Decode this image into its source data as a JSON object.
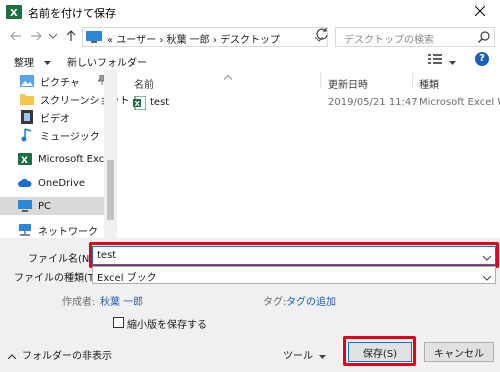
{
  "window": {
    "title": "名前を付けて保存",
    "icon": "excel-icon"
  },
  "navigation": {
    "breadcrumb_prefix": "«",
    "breadcrumbs": [
      "ユーザー",
      "秋葉 一郎",
      "デスクトップ"
    ],
    "separator": "›",
    "search_placeholder": "デスクトップの検索"
  },
  "toolbar": {
    "organize_label": "整理",
    "new_folder_label": "新しいフォルダー"
  },
  "sidebar": {
    "items": [
      {
        "label": "ピクチャ",
        "icon": "pictures-icon",
        "pinned": true
      },
      {
        "label": "スクリーンショット",
        "icon": "folder-icon"
      },
      {
        "label": "ビデオ",
        "icon": "video-icon"
      },
      {
        "label": "ミュージック",
        "icon": "music-icon"
      },
      {
        "label": "Microsoft Excel",
        "icon": "excel-icon"
      },
      {
        "label": "OneDrive",
        "icon": "onedrive-icon"
      },
      {
        "label": "PC",
        "icon": "pc-icon",
        "selected": true
      },
      {
        "label": "ネットワーク",
        "icon": "network-icon"
      }
    ]
  },
  "file_list": {
    "columns": [
      "名前",
      "更新日時",
      "種類"
    ],
    "rows": [
      {
        "name": "test",
        "modified": "2019/05/21 11:47",
        "type": "Microsoft Excel W..."
      }
    ]
  },
  "form": {
    "filename_label": "ファイル名(N):",
    "filename_value": "test",
    "filetype_label": "ファイルの種類(T):",
    "filetype_value": "Excel ブック",
    "author_label": "作成者:",
    "author_value": "秋葉 一郎",
    "tags_label": "タグ:",
    "tags_value": "タグの追加",
    "thumbnail_label": "縮小版を保存する"
  },
  "footer": {
    "hide_folders_label": "フォルダーの非表示",
    "tools_label": "ツール",
    "save_label": "保存(S)",
    "cancel_label": "キャンセル"
  },
  "colors": {
    "accent": "#0078d7",
    "highlight": "#e0001a",
    "link": "#1c5fb8",
    "excel_green": "#1d6f42"
  }
}
